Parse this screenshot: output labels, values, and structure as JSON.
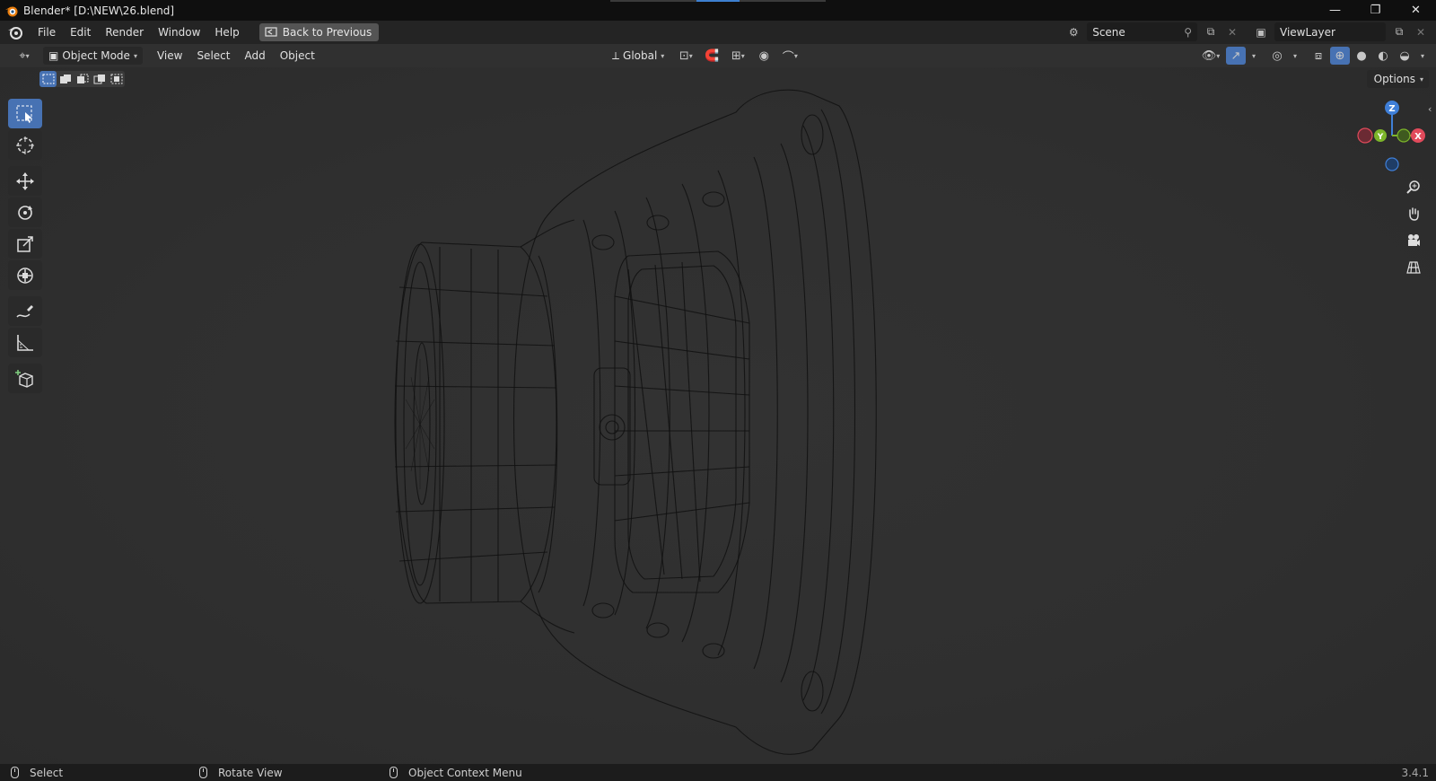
{
  "window": {
    "title": "Blender* [D:\\NEW\\26.blend]",
    "minimize_icon": "—",
    "maximize_icon": "❐",
    "close_icon": "✕"
  },
  "menubar": {
    "items": [
      "File",
      "Edit",
      "Render",
      "Window",
      "Help"
    ],
    "back_button": "Back to Previous",
    "scene": {
      "label": "Scene",
      "icon": "scene-icon"
    },
    "view_layer": {
      "label": "ViewLayer",
      "icon": "render-layers-icon"
    }
  },
  "viewport_header": {
    "mode": "Object Mode",
    "menus": [
      "View",
      "Select",
      "Add",
      "Object"
    ],
    "orientation": "Global",
    "options_label": "Options",
    "shading_active": "wireframe"
  },
  "toolbar": {
    "active_tool": "select-box",
    "tools": [
      "select-box",
      "cursor",
      "move",
      "rotate",
      "scale",
      "transform",
      "annotate",
      "measure",
      "add-cube"
    ]
  },
  "gizmo": {
    "axes": [
      "Z",
      "Y",
      "X"
    ],
    "colors": {
      "x": "#e14a5b",
      "y": "#7db52a",
      "z": "#3f7fd8"
    }
  },
  "statusbar": {
    "select": "Select",
    "rotate_view": "Rotate View",
    "context_menu": "Object Context Menu",
    "version": "3.4.1"
  },
  "colors": {
    "active_blue": "#4772b3",
    "viewport_bg": "#303030"
  }
}
